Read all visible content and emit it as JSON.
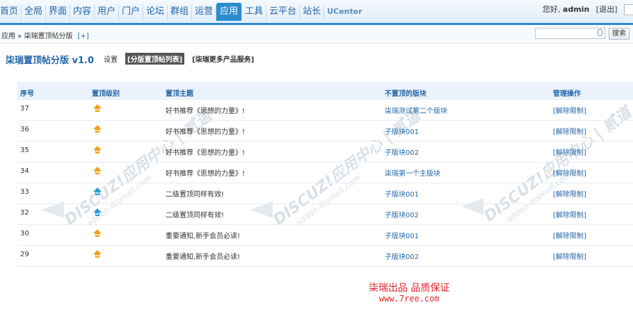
{
  "nav": {
    "items": [
      "首页",
      "全局",
      "界面",
      "内容",
      "用户",
      "门户",
      "论坛",
      "群组",
      "运营",
      "应用",
      "工具",
      "云平台",
      "站长",
      "UCenter"
    ],
    "active_index": 9
  },
  "user": {
    "greeting": "您好,",
    "name": "admin",
    "logout": "[退出]"
  },
  "breadcrumb": {
    "text": "应用 » 柒瑞置顶帖分版",
    "plus": "[+]"
  },
  "search": {
    "placeholder": "",
    "button": "搜索"
  },
  "plugin": {
    "title": "柒瑞置顶帖分版 v1.0",
    "tabs": {
      "settings": "设置",
      "list": "[分版置顶帖列表]",
      "more": "[柒瑞更多产品服务]"
    }
  },
  "table": {
    "headers": [
      "序号",
      "置顶级别",
      "置顶主题",
      "不置顶的版块",
      "管理操作"
    ],
    "rows": [
      {
        "id": "37",
        "level": "orange",
        "subject": "好书推荐《思想的力量》!",
        "forum": "柒瑞测试第二个版块",
        "op": "[解除限制]"
      },
      {
        "id": "36",
        "level": "orange",
        "subject": "好书推荐《思想的力量》!",
        "forum": "子版块001",
        "op": "[解除限制]"
      },
      {
        "id": "35",
        "level": "orange",
        "subject": "好书推荐《思想的力量》!",
        "forum": "子版块002",
        "op": "[解除限制]"
      },
      {
        "id": "34",
        "level": "orange",
        "subject": "好书推荐《思想的力量》!",
        "forum": "柒瑞第一个主版块",
        "op": "[解除限制]"
      },
      {
        "id": "33",
        "level": "blue",
        "subject": "二级置顶同样有效!",
        "forum": "子版块001",
        "op": "[解除限制]"
      },
      {
        "id": "32",
        "level": "blue",
        "subject": "二级置顶同样有效!",
        "forum": "子版块002",
        "op": "[解除限制]"
      },
      {
        "id": "30",
        "level": "orange",
        "subject": "重要通知,新手会员必读!",
        "forum": "子版块001",
        "op": "[解除限制]"
      },
      {
        "id": "29",
        "level": "orange",
        "subject": "重要通知,新手会员必读!",
        "forum": "子版块002",
        "op": "[解除限制]"
      }
    ]
  },
  "watermark": {
    "brand": "DISCUZ!应用中心 | 贰道",
    "url": "addon.dismall.com"
  },
  "promo": {
    "text": "柒瑞出品  品质保证",
    "url": "www.7ree.com"
  },
  "colors": {
    "accent": "#2b8cd0",
    "link": "#2366a8",
    "pin_orange": "#f0a21c",
    "pin_blue": "#2a9ed8",
    "promo": "#e0242a"
  }
}
